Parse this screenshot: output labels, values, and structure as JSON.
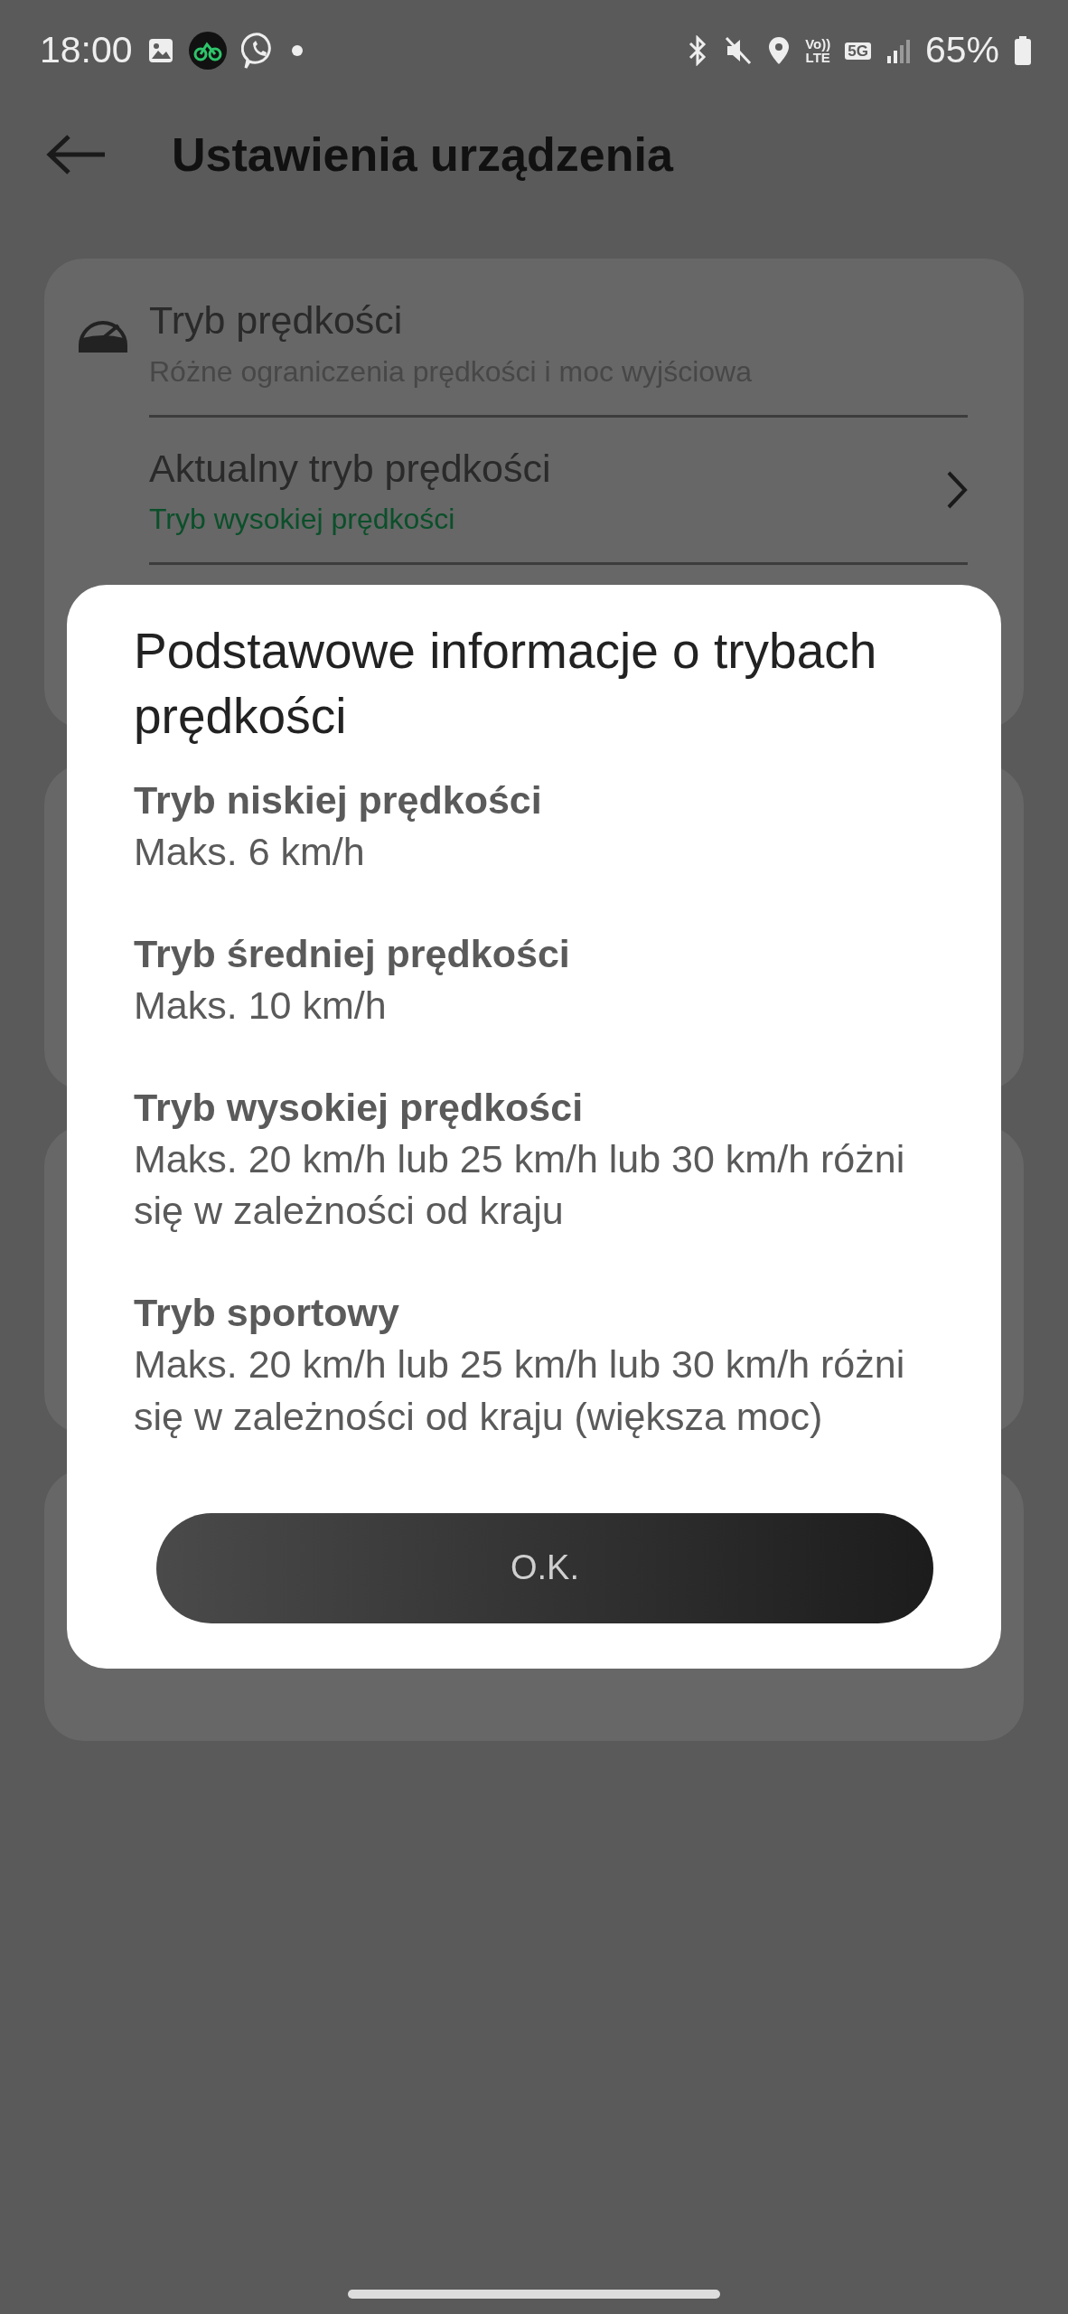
{
  "status_bar": {
    "time": "18:00",
    "volte_top": "Vo))",
    "volte_bottom": "LTE",
    "network": "5G",
    "battery": "65%"
  },
  "header": {
    "title": "Ustawienia urządzenia"
  },
  "settings_card": {
    "title": "Tryb prędkości",
    "subtitle": "Różne ograniczenia prędkości i moc wyjściowa",
    "rows": [
      {
        "label": "Aktualny tryb prędkości",
        "value": "Tryb wysokiej prędkości"
      }
    ]
  },
  "dialog": {
    "title": "Podstawowe informacje o trybach prędkości",
    "modes": [
      {
        "name": "Tryb niskiej prędkości",
        "description": "Maks. 6 km/h"
      },
      {
        "name": "Tryb średniej prędkości",
        "description": "Maks. 10 km/h"
      },
      {
        "name": "Tryb wysokiej prędkości",
        "description": "Maks. 20 km/h lub 25 km/h lub 30 km/h różni się w zależności od kraju"
      },
      {
        "name": "Tryb sportowy",
        "description": "Maks. 20 km/h lub 25 km/h lub 30 km/h różni się w zależności od kraju (większa moc)"
      }
    ],
    "button": "O.K."
  }
}
